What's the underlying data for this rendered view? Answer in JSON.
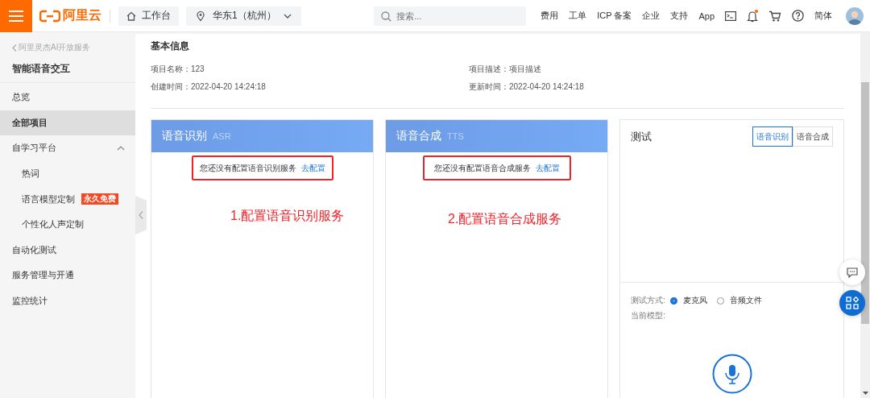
{
  "topbar": {
    "logo": "阿里云",
    "workbench": "工作台",
    "region": "华东1（杭州）",
    "search": {
      "placeholder": "搜索..."
    },
    "links": [
      "费用",
      "工单",
      "ICP 备案",
      "企业",
      "支持",
      "App"
    ],
    "language": "简体"
  },
  "sidebar": {
    "back": "阿里灵杰AI开放服务",
    "title": "智能语音交互",
    "items": [
      {
        "label": "总览",
        "selected": false
      },
      {
        "label": "全部项目",
        "selected": true
      },
      {
        "label": "自学习平台",
        "selected": false,
        "expanded": true,
        "children": [
          {
            "label": "热词",
            "selected": false
          },
          {
            "label": "语言模型定制",
            "selected": false,
            "badge": "永久免费"
          },
          {
            "label": "个性化人声定制",
            "selected": false
          }
        ]
      },
      {
        "label": "自动化测试",
        "selected": false
      },
      {
        "label": "服务管理与开通",
        "selected": false
      },
      {
        "label": "监控统计",
        "selected": false
      }
    ]
  },
  "info": {
    "title": "基本信息",
    "fields": [
      {
        "label": "项目名称：",
        "value": "123"
      },
      {
        "label": "项目描述：",
        "value": "项目描述"
      },
      {
        "label": "创建时间：",
        "value": "2022-04-20 14:24:18"
      },
      {
        "label": "更新时间：",
        "value": "2022-04-20 14:24:18"
      }
    ]
  },
  "services": [
    {
      "title": "语音识别",
      "subtitle": "ASR",
      "message": "您还没有配置语音识别服务",
      "link": "去配置",
      "annotation": "1.配置语音识别服务"
    },
    {
      "title": "语音合成",
      "subtitle": "TTS",
      "message": "您还没有配置语音合成服务",
      "link": "去配置",
      "annotation": "2.配置语音合成服务"
    }
  ],
  "test": {
    "title": "测试",
    "tabs": [
      {
        "label": "语音识别",
        "selected": true
      },
      {
        "label": "语音合成",
        "selected": false
      }
    ],
    "mode_label": "测试方式:",
    "modes": [
      {
        "label": "麦克风",
        "selected": true
      },
      {
        "label": "音频文件",
        "selected": false
      }
    ],
    "model_label": "当前模型:"
  }
}
